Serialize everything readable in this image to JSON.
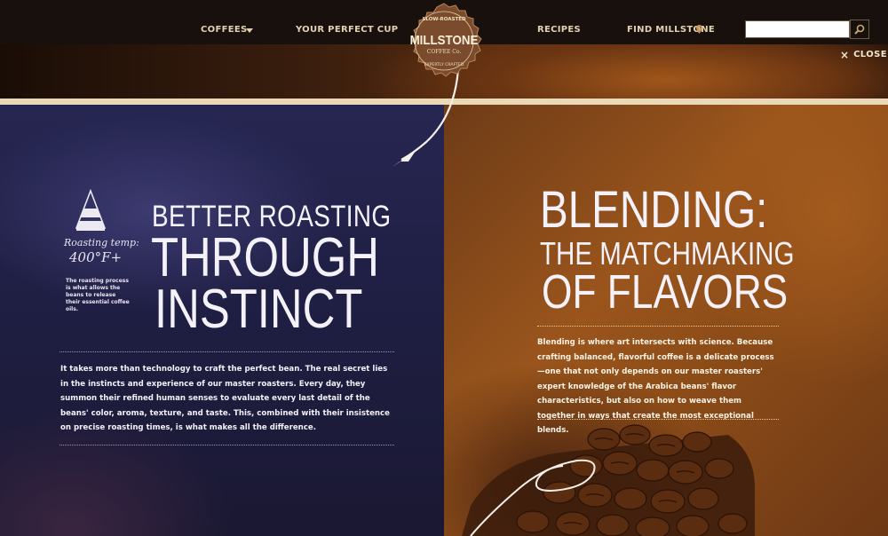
{
  "nav": {
    "items": [
      "COFFEES",
      "YOUR PERFECT CUP",
      "RECIPES",
      "FIND MILLSTONE"
    ],
    "search": {
      "placeholder": "",
      "value": ""
    }
  },
  "logo": {
    "top": "SLOW-ROASTED",
    "name": "MILLSTONE",
    "sub": "COFFEE Co.",
    "bottom": "EXPERTLY CRAFTED"
  },
  "close": {
    "label": "CLOSE"
  },
  "left": {
    "icon_label": "Roasting temp:",
    "icon_value": "400°F+",
    "icon_note": "The roasting process is what allows the beans to release their essential coffee oils.",
    "heading": [
      "BETTER ROASTING",
      "THROUGH",
      "INSTINCT"
    ],
    "body": "It takes more than technology to craft the perfect bean. The real secret lies in the instincts and experience of our master roasters. Every day, they summon their refined human senses to evaluate every last detail of the beans' color, aroma, texture, and taste. This, combined with their insistence on precise roasting times, is what makes all the difference."
  },
  "right": {
    "heading": [
      "BLENDING:",
      "THE MATCHMAKING",
      "OF FLAVORS"
    ],
    "body": "Blending is where art intersects with science. Because crafting balanced, flavorful coffee is a delicate process—one that not only depends on our master roasters' expert knowledge of the Arabica beans' flavor characteristics, but also on how to weave them together in ways that create the most exceptional blends."
  },
  "colors": {
    "nav_bg": "#17100d",
    "nav_text": "#e3d2b0",
    "cream": "#e9d9b6",
    "left_bg": "#22224a",
    "right_bg": "#8c4c18"
  }
}
